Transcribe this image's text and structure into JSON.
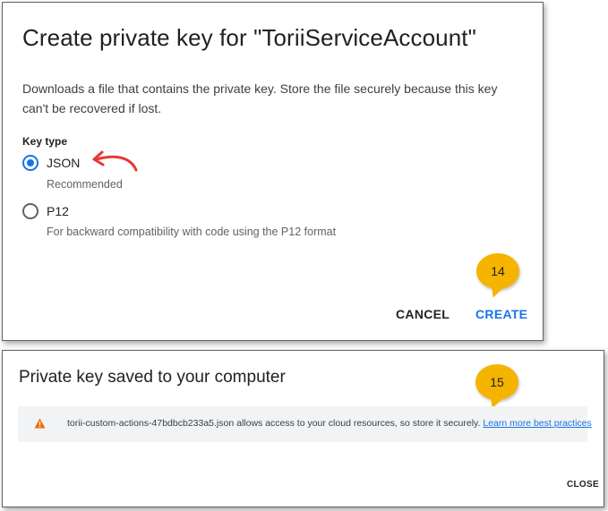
{
  "dialog1": {
    "title": "Create private key for \"ToriiServiceAccount\"",
    "description": "Downloads a file that contains the private key. Store the file securely because this key can't be recovered if lost.",
    "key_type_label": "Key type",
    "options": [
      {
        "label": "JSON",
        "sub": "Recommended",
        "selected": true
      },
      {
        "label": "P12",
        "sub": "For backward compatibility with code using the P12 format",
        "selected": false
      }
    ],
    "cancel_label": "CANCEL",
    "create_label": "CREATE",
    "step_badge": "14"
  },
  "dialog2": {
    "title": "Private key saved to your computer",
    "alert_text": "torii-custom-actions-47bdbcb233a5.json allows access to your cloud resources, so store it securely.",
    "alert_link": "Learn more best practices",
    "close_label": "CLOSE",
    "step_badge": "15"
  },
  "colors": {
    "accent": "#1a73e8",
    "badge": "#f4b400",
    "annotation_arrow": "#e53935",
    "warning": "#e8710a"
  }
}
